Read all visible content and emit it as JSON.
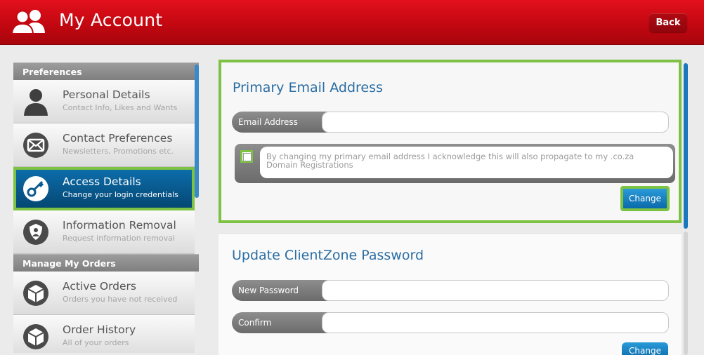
{
  "header": {
    "title": "My Account",
    "back_label": "Back"
  },
  "sidebar": {
    "sections": [
      {
        "title": "Preferences"
      },
      {
        "title": "Manage My Orders"
      }
    ],
    "items": [
      {
        "title": "Personal Details",
        "subtitle": "Contact Info, Likes and Wants",
        "icon": "person-icon"
      },
      {
        "title": "Contact Preferences",
        "subtitle": "Newsletters, Promotions etc.",
        "icon": "envelope-icon"
      },
      {
        "title": "Access Details",
        "subtitle": "Change your login credentials",
        "icon": "key-icon"
      },
      {
        "title": "Information Removal",
        "subtitle": "Request information removal",
        "icon": "shield-icon"
      },
      {
        "title": "Active Orders",
        "subtitle": "Orders you have not received",
        "icon": "box-icon"
      },
      {
        "title": "Order History",
        "subtitle": "All of your orders",
        "icon": "box-icon"
      }
    ],
    "active_index": 2
  },
  "email_panel": {
    "title": "Primary Email Address",
    "email_label": "Email Address",
    "email_value": "",
    "consent_text": "By changing my primary email address I acknowledge this will also propagate to my .co.za Domain Registrations",
    "change_label": "Change"
  },
  "password_panel": {
    "title": "Update ClientZone Password",
    "new_password_label": "New Password",
    "confirm_label": "Confirm",
    "change_label": "Change"
  },
  "colors": {
    "header_red": "#c00710",
    "accent_blue": "#0b6aab",
    "highlight_green": "#7dc242",
    "title_blue": "#2a6da3"
  }
}
